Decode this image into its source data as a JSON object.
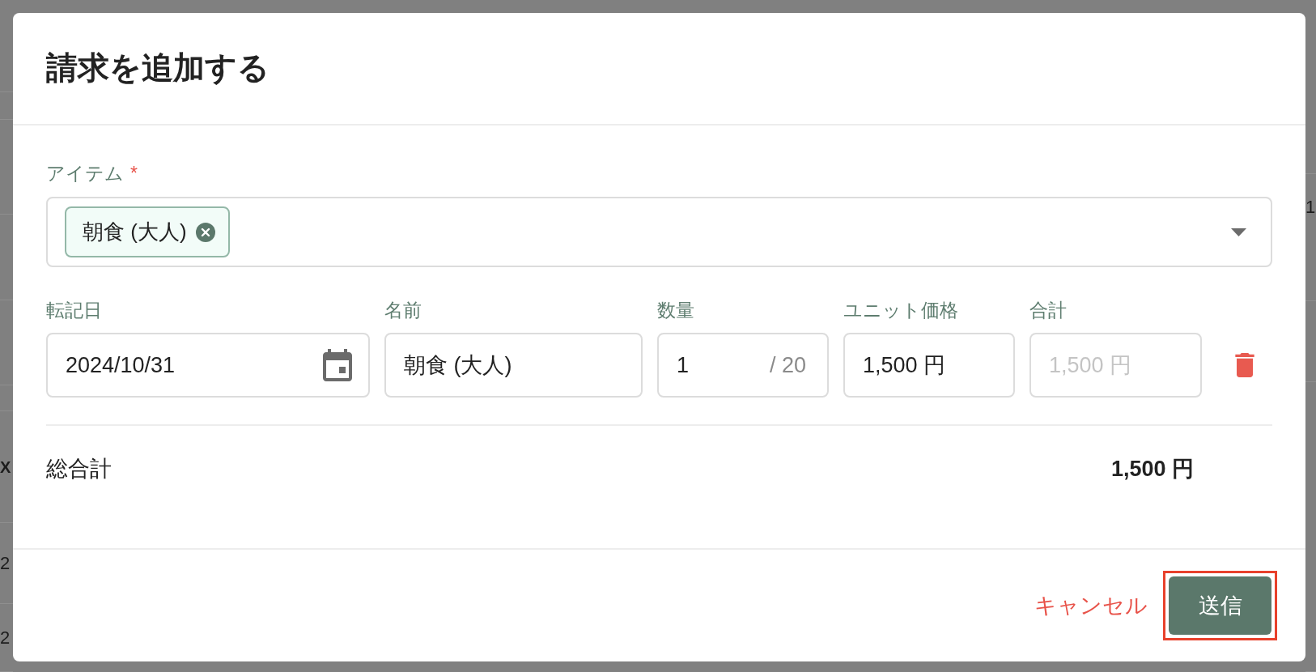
{
  "backdrop": {
    "left_texts": [
      {
        "text": "X",
        "bold": true
      },
      {
        "text": "2",
        "bold": false
      },
      {
        "text": "2",
        "bold": false
      }
    ],
    "right_texts": [
      {
        "text": "1",
        "bold": false
      }
    ]
  },
  "dialog": {
    "title": "請求を追加する",
    "item_select": {
      "label": "アイテム",
      "required_mark": "*",
      "chips": [
        {
          "text": "朝食 (大人)"
        }
      ]
    },
    "fields": [
      {
        "kind": "date",
        "label": "転記日",
        "value": "2024/10/31",
        "disabled": false
      },
      {
        "kind": "text",
        "label": "名前",
        "value": "朝食 (大人)",
        "disabled": false
      },
      {
        "kind": "quantity",
        "label": "数量",
        "value": "1",
        "limit": "/ 20",
        "disabled": false
      },
      {
        "kind": "text",
        "label": "ユニット価格",
        "value": "1,500 円",
        "disabled": false
      },
      {
        "kind": "text",
        "label": "合計",
        "value": "1,500 円",
        "disabled": true
      }
    ],
    "grand_total": {
      "label": "総合計",
      "value": "1,500 円"
    },
    "buttons": [
      {
        "kind": "text",
        "label": "キャンセル",
        "highlighted": false
      },
      {
        "kind": "primary",
        "label": "送信",
        "highlighted": true
      }
    ]
  }
}
